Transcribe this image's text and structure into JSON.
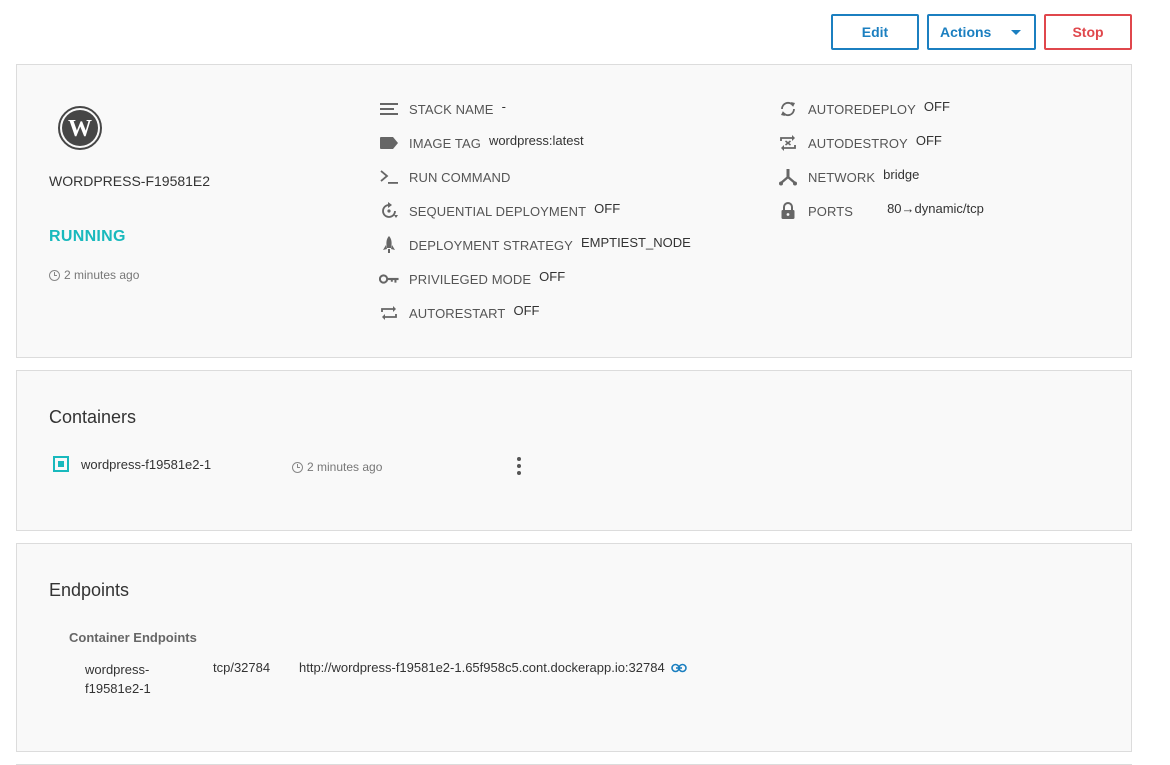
{
  "toolbar": {
    "edit_label": "Edit",
    "actions_label": "Actions",
    "stop_label": "Stop"
  },
  "service": {
    "logo": "wordpress-logo",
    "name": "WORDPRESS-F19581E2",
    "status": "RUNNING",
    "time": "2 minutes ago"
  },
  "properties_left": [
    {
      "icon": "lines-icon",
      "label": "STACK NAME",
      "value": "-"
    },
    {
      "icon": "tag-icon",
      "label": "IMAGE TAG",
      "value": "wordpress:latest"
    },
    {
      "icon": "terminal-icon",
      "label": "RUN COMMAND",
      "value": ""
    },
    {
      "icon": "sequential-icon",
      "label": "SEQUENTIAL DEPLOYMENT",
      "value": "OFF"
    },
    {
      "icon": "rocket-icon",
      "label": "DEPLOYMENT STRATEGY",
      "value": "EMPTIEST_NODE"
    },
    {
      "icon": "key-icon",
      "label": "PRIVILEGED MODE",
      "value": "OFF"
    },
    {
      "icon": "repeat-icon",
      "label": "AUTORESTART",
      "value": "OFF"
    }
  ],
  "properties_right": [
    {
      "icon": "refresh-icon",
      "label": "AUTOREDEPLOY",
      "value": "OFF"
    },
    {
      "icon": "autodestroy-icon",
      "label": "AUTODESTROY",
      "value": "OFF"
    },
    {
      "icon": "network-icon",
      "label": "NETWORK",
      "value": "bridge"
    },
    {
      "icon": "lock-icon",
      "label": "PORTS",
      "value": "80→dynamic/tcp"
    }
  ],
  "containers": {
    "title": "Containers",
    "items": [
      {
        "name": "wordpress-f19581e2-1",
        "time": "2 minutes ago"
      }
    ]
  },
  "endpoints": {
    "title": "Endpoints",
    "subtitle": "Container Endpoints",
    "items": [
      {
        "name": "wordpress-f19581e2-1",
        "port": "tcp/32784",
        "url": "http://wordpress-f19581e2-1.65f958c5.cont.dockerapp.io:32784"
      }
    ]
  },
  "colors": {
    "accent": "#1b7fc0",
    "danger": "#e0474c",
    "running": "#19b9bd"
  }
}
